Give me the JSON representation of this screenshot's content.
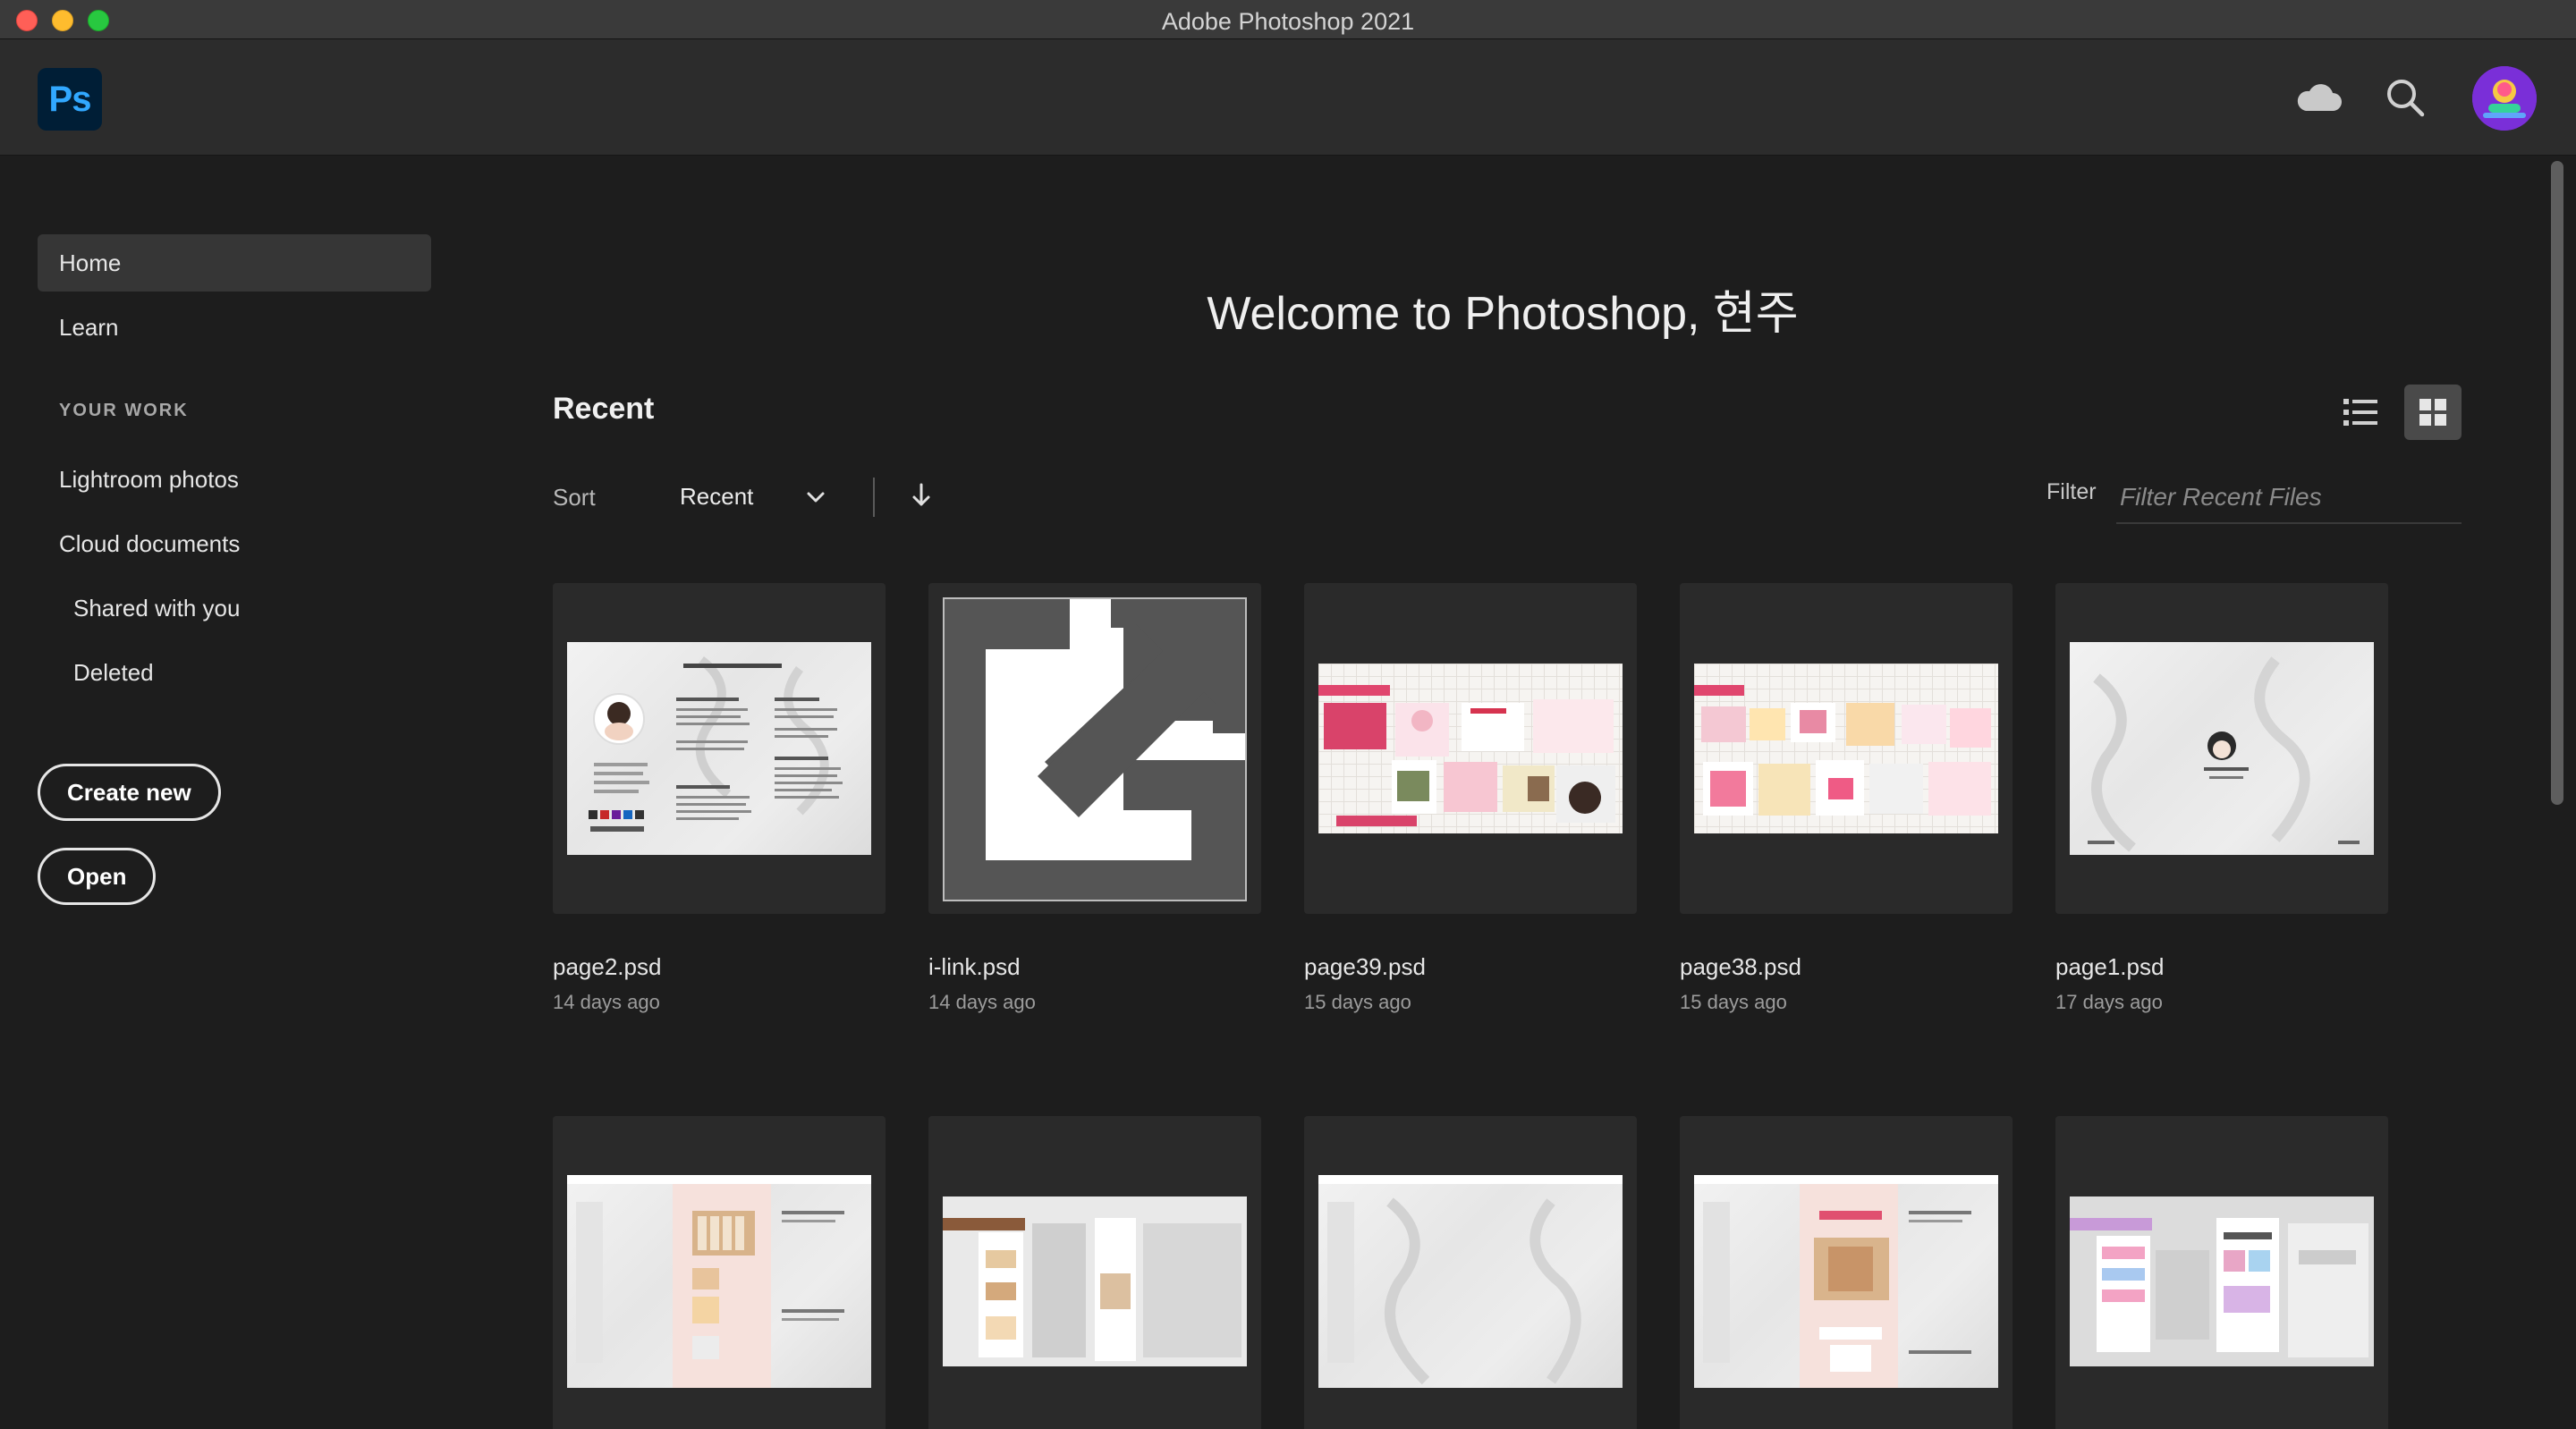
{
  "window": {
    "title": "Adobe Photoshop 2021"
  },
  "header": {
    "logo_text": "Ps",
    "icons": [
      "cloud-icon",
      "search-icon",
      "avatar"
    ]
  },
  "sidebar": {
    "items": [
      {
        "label": "Home"
      },
      {
        "label": "Learn"
      },
      {
        "label": "Lightroom photos"
      },
      {
        "label": "Cloud documents"
      },
      {
        "label": "Shared with you"
      },
      {
        "label": "Deleted"
      }
    ],
    "section_label": "YOUR WORK",
    "create_new_label": "Create new",
    "open_label": "Open"
  },
  "main": {
    "welcome": "Welcome to Photoshop, 현주",
    "recent_title": "Recent",
    "sort_label": "Sort",
    "sort_value": "Recent",
    "filter_label": "Filter",
    "filter_placeholder": "Filter Recent Files",
    "files": [
      {
        "name": "page2.psd",
        "date": "14 days ago"
      },
      {
        "name": "i-link.psd",
        "date": "14 days ago"
      },
      {
        "name": "page39.psd",
        "date": "15 days ago"
      },
      {
        "name": "page38.psd",
        "date": "15 days ago"
      },
      {
        "name": "page1.psd",
        "date": "17 days ago"
      }
    ]
  },
  "colors": {
    "accent_ps": "#31a8ff",
    "logo_bg": "#001e36",
    "background": "#1d1d1d",
    "header": "#2c2c2c"
  }
}
